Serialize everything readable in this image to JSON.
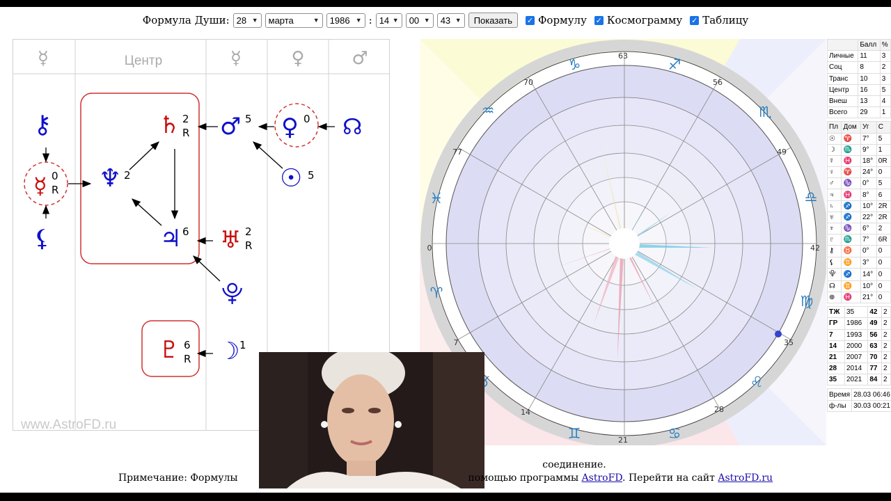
{
  "topbar": {
    "label": "Формула Души:",
    "day": "28",
    "month": "марта",
    "year": "1986",
    "time_sep": ":",
    "hour": "14",
    "minute": "00",
    "second": "43",
    "show_button": "Показать",
    "cb_formula": "Формулу",
    "cb_cosmogram": "Космограмму",
    "cb_table": "Таблицу"
  },
  "formula": {
    "headers": [
      "☿",
      "Центр",
      "☿",
      "♀",
      "♂"
    ],
    "nodes": {
      "chiron": {
        "glyph": "⚷",
        "num": ""
      },
      "mercury_r": {
        "glyph": "☿",
        "num": "0",
        "retro": "R"
      },
      "lilith": {
        "glyph": "⚸",
        "num": ""
      },
      "neptune": {
        "glyph": "♆",
        "num": "2"
      },
      "saturn": {
        "glyph": "♄",
        "num": "2",
        "retro": "R"
      },
      "jupiter": {
        "glyph": "♃",
        "num": "6"
      },
      "mars": {
        "glyph": "♂",
        "num": "5"
      },
      "venus": {
        "glyph": "♀",
        "num": "0"
      },
      "node": {
        "glyph": "☊",
        "num": ""
      },
      "sun": {
        "glyph": "☉",
        "num": "5"
      },
      "uranus": {
        "glyph": "♅",
        "num": "2",
        "retro": "R"
      },
      "proserpina": {
        "glyph": "⯓",
        "num": ""
      },
      "pluto": {
        "glyph": "♇",
        "num": "6",
        "retro": "R"
      },
      "moon": {
        "glyph": "☽",
        "num": "1"
      }
    },
    "watermark": "www.AstroFD.ru"
  },
  "wheel": {
    "degrees": [
      "63",
      "56",
      "49",
      "42",
      "35",
      "28",
      "21",
      "14",
      "7",
      "0",
      "77",
      "70"
    ],
    "signs": [
      "♈",
      "♉",
      "♊",
      "♋",
      "♌",
      "♍",
      "♎",
      "♏",
      "♐",
      "♑",
      "♒",
      "♓"
    ]
  },
  "table": {
    "top_header": [
      "",
      "Балл",
      "%"
    ],
    "top_rows": [
      [
        "Личные",
        "11",
        "3"
      ],
      [
        "Соц",
        "8",
        "2"
      ],
      [
        "Транс",
        "10",
        "3"
      ],
      [
        "Центр",
        "16",
        "5"
      ],
      [
        "Внеш",
        "13",
        "4"
      ],
      [
        "Всего",
        "29",
        "1"
      ]
    ],
    "planet_header": [
      "Пл",
      "Дом",
      "Уг",
      "С"
    ],
    "planet_rows": [
      [
        "☉",
        "♈",
        "7°",
        "5"
      ],
      [
        "☽",
        "♏",
        "9°",
        "1"
      ],
      [
        "☿",
        "♓",
        "18°",
        "0R"
      ],
      [
        "♀",
        "♈",
        "24°",
        "0"
      ],
      [
        "♂",
        "♑",
        "0°",
        "5"
      ],
      [
        "♃",
        "♓",
        "8°",
        "6"
      ],
      [
        "♄",
        "♐",
        "10°",
        "2R"
      ],
      [
        "♅",
        "♐",
        "22°",
        "2R"
      ],
      [
        "♆",
        "♑",
        "6°",
        "2"
      ],
      [
        "♇",
        "♏",
        "7°",
        "6R"
      ],
      [
        "⚷",
        "♉",
        "0°",
        "0"
      ],
      [
        "⚸",
        "♊",
        "3°",
        "0"
      ],
      [
        "⯓",
        "♐",
        "14°",
        "0"
      ],
      [
        "☊",
        "♊",
        "10°",
        "0"
      ],
      [
        "⊕",
        "♓",
        "21°",
        "0"
      ]
    ],
    "age_rows": [
      [
        "ТЖ",
        "35",
        "42",
        "2"
      ],
      [
        "ГР",
        "1986",
        "49",
        "2"
      ],
      [
        "7",
        "1993",
        "56",
        "2"
      ],
      [
        "14",
        "2000",
        "63",
        "2"
      ],
      [
        "21",
        "2007",
        "70",
        "2"
      ],
      [
        "28",
        "2014",
        "77",
        "2"
      ],
      [
        "35",
        "2021",
        "84",
        "2"
      ]
    ],
    "time_rows": [
      [
        "Время",
        "28.03 06:46"
      ],
      [
        "ф-лы",
        "30.03 00:21"
      ]
    ]
  },
  "footer": {
    "line1_tail": "соединение.",
    "line2_prefix": "Примечание: Формулы",
    "line2_middle": "помощью программы",
    "link1": "AstroFD",
    "line2_sep": ". Перейти на сайт",
    "link2": "AstroFD.ru"
  },
  "colors": {
    "blue": "#1010c8",
    "red": "#c81010",
    "checkbox": "#1a73e8",
    "link": "#1a0dab"
  }
}
